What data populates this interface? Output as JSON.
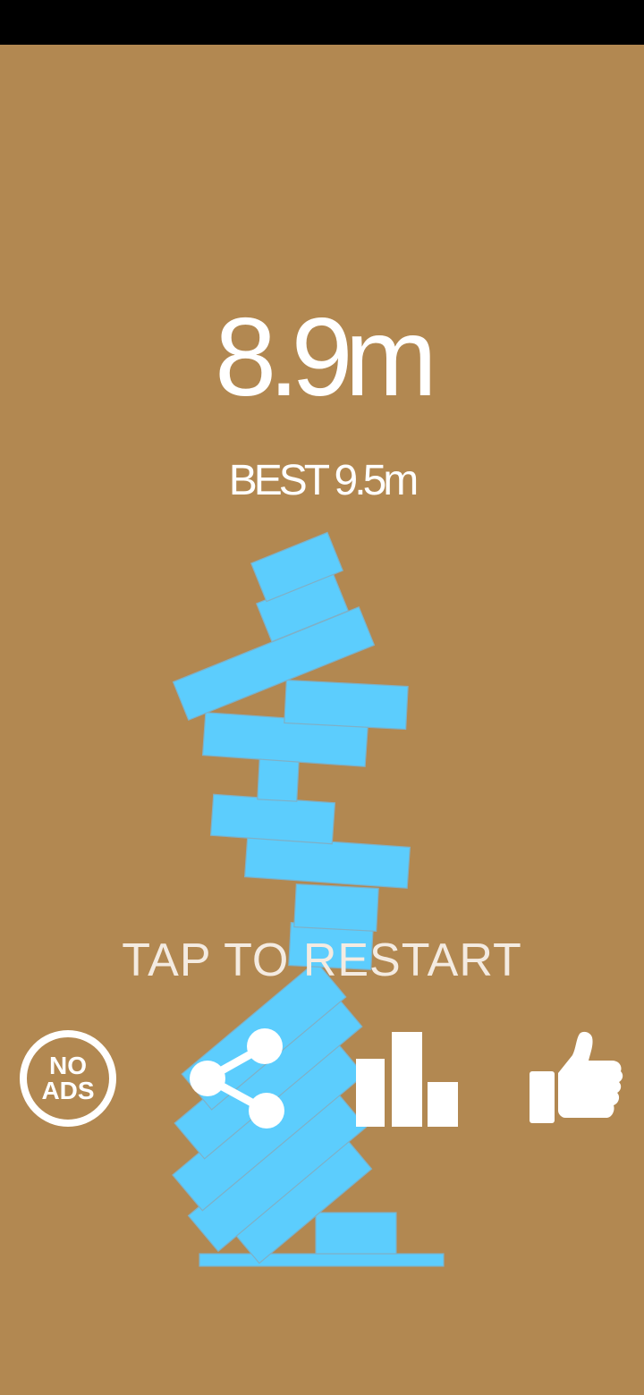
{
  "game": {
    "score": "8.9m",
    "best": "BEST 9.5m",
    "restart_prompt": "TAP TO RESTART"
  },
  "buttons": {
    "no_ads": {
      "line1": "NO",
      "line2": "ADS",
      "icon": "no-ads-icon"
    },
    "share": {
      "icon": "share-icon"
    },
    "leaderboard": {
      "icon": "bar-chart-icon"
    },
    "like": {
      "icon": "thumbs-up-icon"
    }
  },
  "colors": {
    "background": "#b28851",
    "block": "#5ccdfd",
    "text": "#ffffff",
    "status_bar": "#000000"
  }
}
